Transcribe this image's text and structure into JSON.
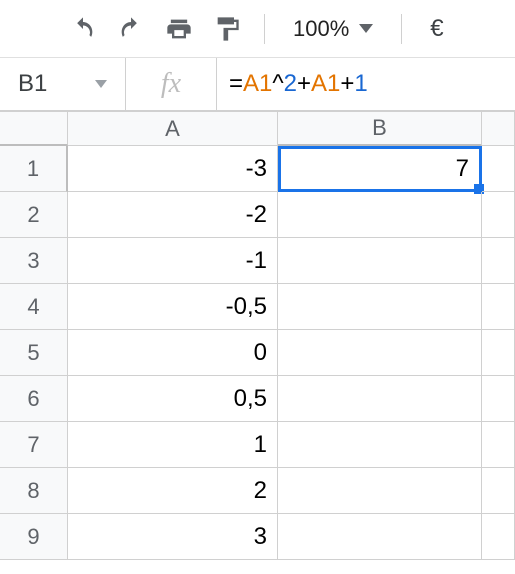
{
  "toolbar": {
    "zoom_label": "100%",
    "currency_label": "€"
  },
  "formula_bar": {
    "name_box": "B1",
    "fx_label": "fx",
    "formula_tokens": [
      {
        "t": "op",
        "v": "="
      },
      {
        "t": "ref",
        "v": "A1"
      },
      {
        "t": "op",
        "v": "^"
      },
      {
        "t": "num",
        "v": "2"
      },
      {
        "t": "op",
        "v": "+"
      },
      {
        "t": "ref",
        "v": "A1"
      },
      {
        "t": "op",
        "v": "+"
      },
      {
        "t": "num",
        "v": "1"
      }
    ]
  },
  "columns": [
    "A",
    "B"
  ],
  "rows": [
    {
      "n": "1",
      "A": "-3",
      "B": "7"
    },
    {
      "n": "2",
      "A": "-2",
      "B": ""
    },
    {
      "n": "3",
      "A": "-1",
      "B": ""
    },
    {
      "n": "4",
      "A": "-0,5",
      "B": ""
    },
    {
      "n": "5",
      "A": "0",
      "B": ""
    },
    {
      "n": "6",
      "A": "0,5",
      "B": ""
    },
    {
      "n": "7",
      "A": "1",
      "B": ""
    },
    {
      "n": "8",
      "A": "2",
      "B": ""
    },
    {
      "n": "9",
      "A": "3",
      "B": ""
    }
  ],
  "selected_cell": "B1"
}
